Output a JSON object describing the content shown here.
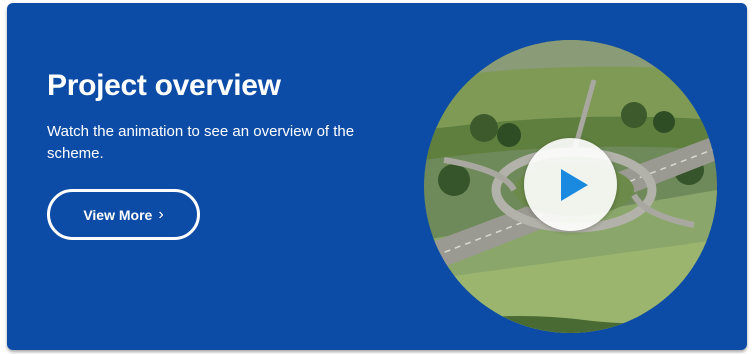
{
  "panel": {
    "title": "Project overview",
    "description": "Watch the animation to see an overview of the scheme.",
    "button_label": "View More",
    "button_icon": "chevron-right-icon",
    "button_chevron": "›"
  },
  "video": {
    "thumbnail": "aerial-view-motorway-junction",
    "play_icon": "play-icon"
  },
  "colors": {
    "panel_background": "#0d4ca6",
    "text": "#ffffff",
    "play_button": "#1a8ae0"
  }
}
